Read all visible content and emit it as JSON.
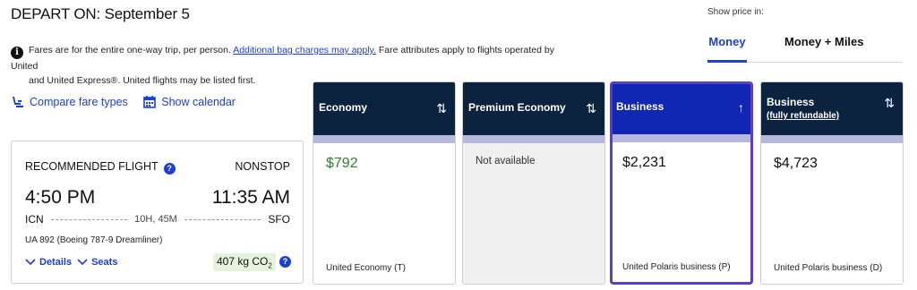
{
  "header": {
    "depart_label": "DEPART ON:",
    "depart_date": "September 5"
  },
  "notice": {
    "info_icon": "info-icon",
    "text_before_link": "Fares are for the entire one-way trip, per person.",
    "link_text": "Additional bag charges may apply.",
    "text_after_link": "Fare attributes apply to flights operated by United",
    "line2": "and United Express®. United flights may be listed first."
  },
  "price_toggle": {
    "label": "Show price in:",
    "options": [
      "Money",
      "Money + Miles"
    ],
    "selected": "Money",
    "accent_color": "#1a3fd6"
  },
  "links": {
    "compare": "Compare fare types",
    "calendar": "Show calendar"
  },
  "flight": {
    "recommended_label": "RECOMMENDED FLIGHT",
    "help_icon": "?",
    "stops": "NONSTOP",
    "depart_time": "4:50 PM",
    "arrive_time": "11:35 AM",
    "origin": "ICN",
    "duration": "10H, 45M",
    "destination": "SFO",
    "aircraft": "UA 892 (Boeing 787-9 Dreamliner)",
    "details_label": "Details",
    "seats_label": "Seats",
    "co2_value": "407 kg CO",
    "co2_sub": "2",
    "co2_help": "?"
  },
  "fares": [
    {
      "name": "Economy",
      "subtitle": "",
      "sort_icon": "⇅",
      "price": "$792",
      "price_color": "#2e7d32",
      "cabin": "United Economy (T)",
      "available": true,
      "selected": false
    },
    {
      "name": "Premium Economy",
      "subtitle": "",
      "sort_icon": "⇅",
      "price": "",
      "unavailable_text": "Not available",
      "cabin": "",
      "available": false,
      "selected": false
    },
    {
      "name": "Business",
      "subtitle": "",
      "sort_icon": "↑",
      "price": "$2,231",
      "cabin": "United Polaris business (P)",
      "available": true,
      "selected": true
    },
    {
      "name": "Business",
      "subtitle": "(fully refundable)",
      "sort_icon": "⇅",
      "price": "$4,723",
      "cabin": "United Polaris business (D)",
      "available": true,
      "selected": false
    }
  ],
  "colors": {
    "header_navy": "#0c2340",
    "header_selected": "#1226b4",
    "band_lavender": "#b7b8de",
    "selected_border": "#5a3ec8",
    "co2_bg": "#e6f2dd"
  }
}
